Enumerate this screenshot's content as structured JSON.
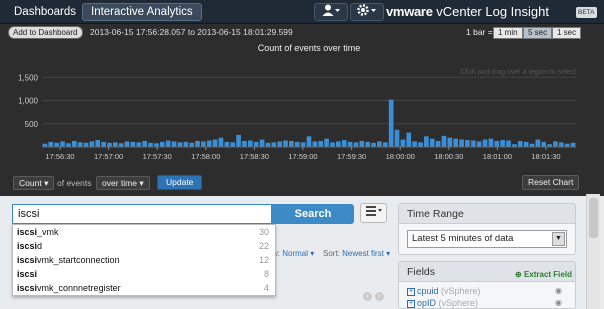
{
  "nav": {
    "dashboards": "Dashboards",
    "interactive": "Interactive Analytics",
    "user_icon": "user-icon",
    "gear_icon": "gear-icon",
    "brand_vm": "vmware",
    "brand_rest": " vCenter Log Insight",
    "beta": "BETA"
  },
  "toolbar": {
    "add_to_dashboard": "Add to Dashboard",
    "date_range": "2013-06-15 17:56:28.057 to 2013-06-15 18:01:29.599",
    "bar_eq": "1 bar =",
    "intervals": [
      "1 min",
      "5 sec",
      "1 sec"
    ],
    "selected_interval": "5 sec"
  },
  "chart_data": {
    "type": "bar",
    "title": "Count of events over time",
    "hint": "Click and drag over a region to select",
    "ylim": [
      0,
      1700
    ],
    "yticks": [
      500,
      1000,
      1500
    ],
    "ytick_labels": [
      "500",
      "1,000",
      "1,500"
    ],
    "xtick_labels": [
      "17:56:30",
      "17:57:00",
      "17:57:30",
      "17:58:00",
      "17:58:30",
      "17:59:00",
      "17:59:30",
      "18:00:00",
      "18:00:30",
      "18:01:00",
      "18:01:30"
    ],
    "values": [
      70,
      110,
      90,
      120,
      80,
      130,
      100,
      90,
      120,
      150,
      110,
      90,
      100,
      80,
      120,
      110,
      100,
      130,
      90,
      80,
      110,
      140,
      120,
      100,
      110,
      90,
      130,
      120,
      140,
      160,
      200,
      110,
      100,
      260,
      130,
      140,
      110,
      160,
      90,
      100,
      120,
      140,
      130,
      110,
      100,
      230,
      120,
      130,
      180,
      100,
      120,
      150,
      110,
      100,
      130,
      110,
      90,
      120,
      100,
      1020,
      370,
      160,
      310,
      120,
      100,
      230,
      180,
      130,
      240,
      200,
      180,
      160,
      150,
      140,
      120,
      160,
      180,
      130,
      150,
      140,
      60,
      130,
      110,
      70,
      160,
      110,
      60,
      120,
      100,
      70,
      90
    ],
    "bar_color": "#3a8fd6",
    "grid": true
  },
  "controls": {
    "metric": "Count",
    "of_events": "of events",
    "grouping": "over time",
    "update": "Update",
    "reset_chart": "Reset Chart"
  },
  "search": {
    "query": "iscsi",
    "button": "Search",
    "suggestions": [
      {
        "bold": "iscsi",
        "rest": "_vmk",
        "count": "30"
      },
      {
        "bold": "iscsi",
        "rest": "d",
        "count": "22"
      },
      {
        "bold": "iscsi",
        "rest": "vmk_startconnection",
        "count": "12"
      },
      {
        "bold": "iscsi",
        "rest": "",
        "count": "8"
      },
      {
        "bold": "iscsi",
        "rest": "vmk_connnetregister",
        "count": "4"
      }
    ]
  },
  "results_bar": {
    "view_label": "w:",
    "view_value": "Normal",
    "sort_label": "Sort:",
    "sort_value": "Newest first"
  },
  "time_range": {
    "title": "Time Range",
    "value": "Latest 5 minutes of data"
  },
  "fields": {
    "title": "Fields",
    "extract": "Extract Field",
    "items": [
      {
        "name": "cpuid",
        "source": "(vSphere)"
      },
      {
        "name": "opID",
        "source": "(vSphere)"
      }
    ]
  }
}
